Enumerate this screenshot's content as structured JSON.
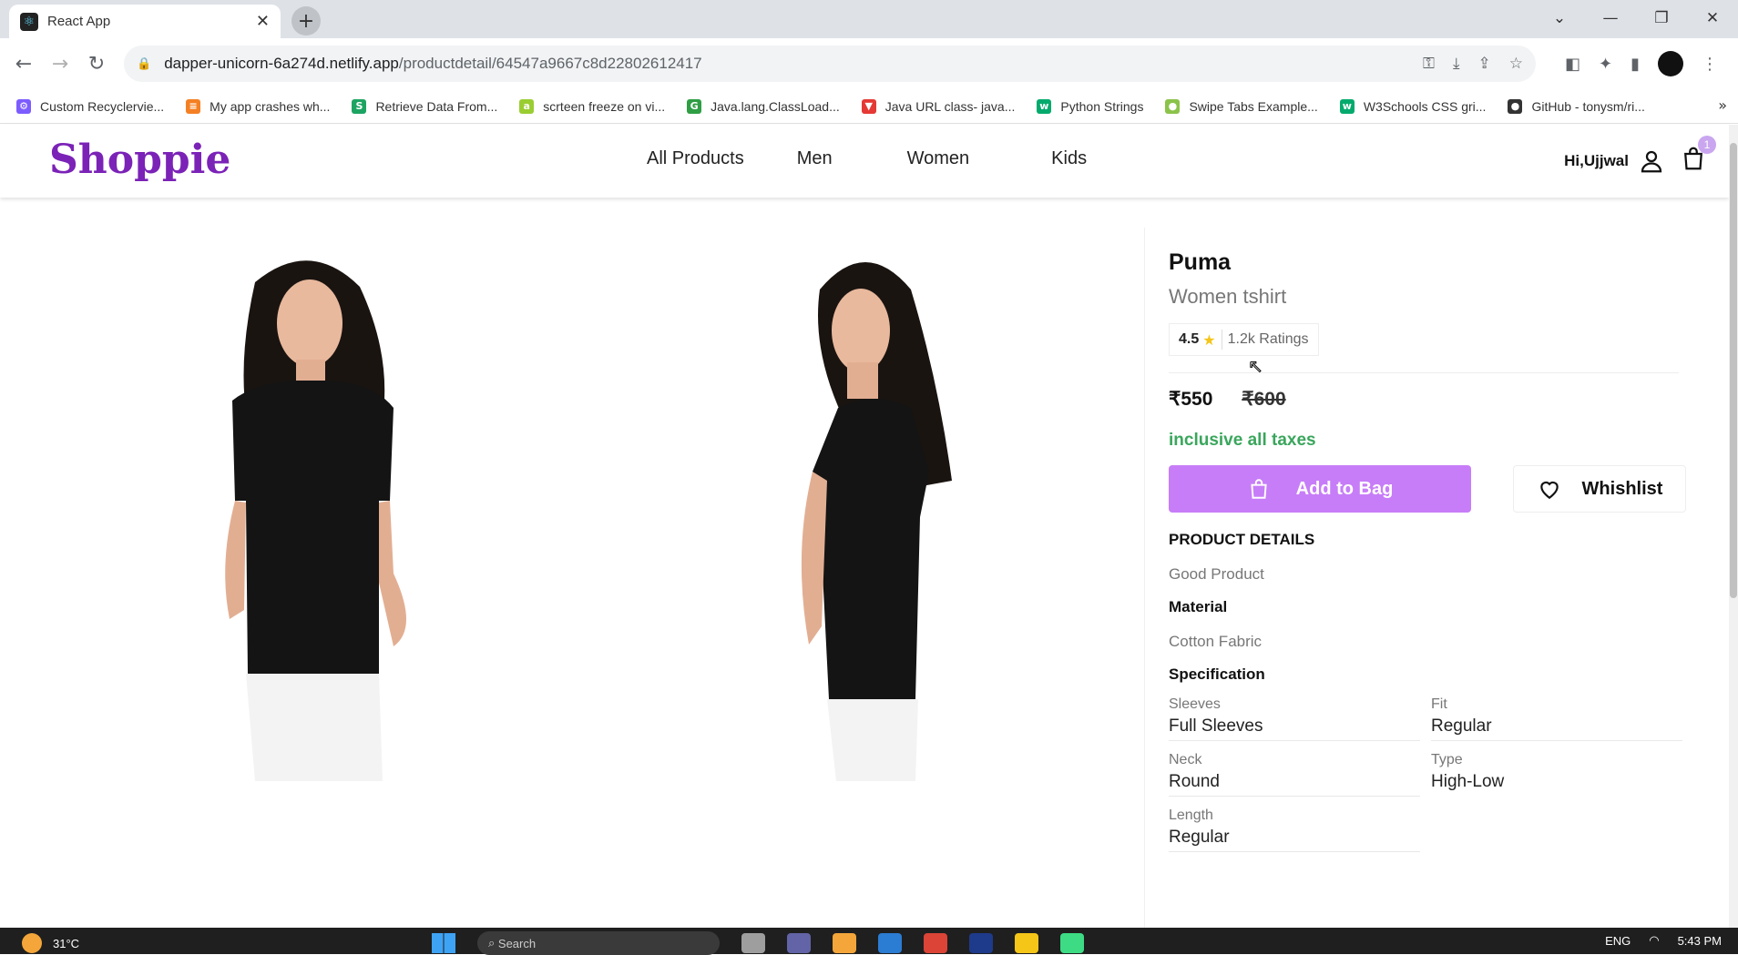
{
  "browser": {
    "tab_title": "React App",
    "tab_close": "✕",
    "new_tab": "+",
    "url_host": "dapper-unicorn-6a274d.netlify.app",
    "url_path": "/productdetail/64547a9667c8d22802612417",
    "bookmarks": [
      {
        "label": "Custom Recyclervie...",
        "color": "#7c5cff",
        "glyph": "⚙"
      },
      {
        "label": "My app crashes wh...",
        "color": "#f48024",
        "glyph": "≡"
      },
      {
        "label": "Retrieve Data From...",
        "color": "#1da462",
        "glyph": "S"
      },
      {
        "label": "scrteen freeze on vi...",
        "color": "#9acd32",
        "glyph": "a"
      },
      {
        "label": "Java.lang.ClassLoad...",
        "color": "#2f9e44",
        "glyph": "G"
      },
      {
        "label": "Java URL class- java...",
        "color": "#e53935",
        "glyph": "▼"
      },
      {
        "label": "Python Strings",
        "color": "#04aa6d",
        "glyph": "w"
      },
      {
        "label": "Swipe Tabs Example...",
        "color": "#8bc34a",
        "glyph": "●"
      },
      {
        "label": "W3Schools CSS gri...",
        "color": "#04aa6d",
        "glyph": "w"
      },
      {
        "label": "GitHub - tonysm/ri...",
        "color": "#333333",
        "glyph": "●"
      }
    ]
  },
  "site": {
    "logo": "Shoppie",
    "nav": [
      "All Products",
      "Men",
      "Women",
      "Kids"
    ],
    "greeting": "Hi,Ujjwal",
    "cart_count": "1"
  },
  "product": {
    "brand": "Puma",
    "name": "Women tshirt",
    "rating": "4.5",
    "rating_count": "1.2k Ratings",
    "price": "₹550",
    "mrp": "₹600",
    "taxes_note": "inclusive all taxes",
    "add_to_bag": "Add to Bag",
    "wishlist": "Whishlist",
    "details_heading": "PRODUCT DETAILS",
    "description": "Good Product",
    "material_heading": "Material",
    "material": "Cotton Fabric",
    "spec_heading": "Specification",
    "specs": [
      {
        "label": "Sleeves",
        "value": "Full Sleeves"
      },
      {
        "label": "Fit",
        "value": "Regular"
      },
      {
        "label": "Neck",
        "value": "Round"
      },
      {
        "label": "Type",
        "value": "High-Low"
      },
      {
        "label": "Length",
        "value": "Regular"
      }
    ]
  },
  "taskbar": {
    "temperature": "31°C",
    "search": "Search",
    "lang": "ENG",
    "time": "5:43 PM"
  },
  "colors": {
    "brand_purple": "#7b22b7",
    "button_purple": "#c77df7",
    "tax_green": "#3aa65c"
  }
}
